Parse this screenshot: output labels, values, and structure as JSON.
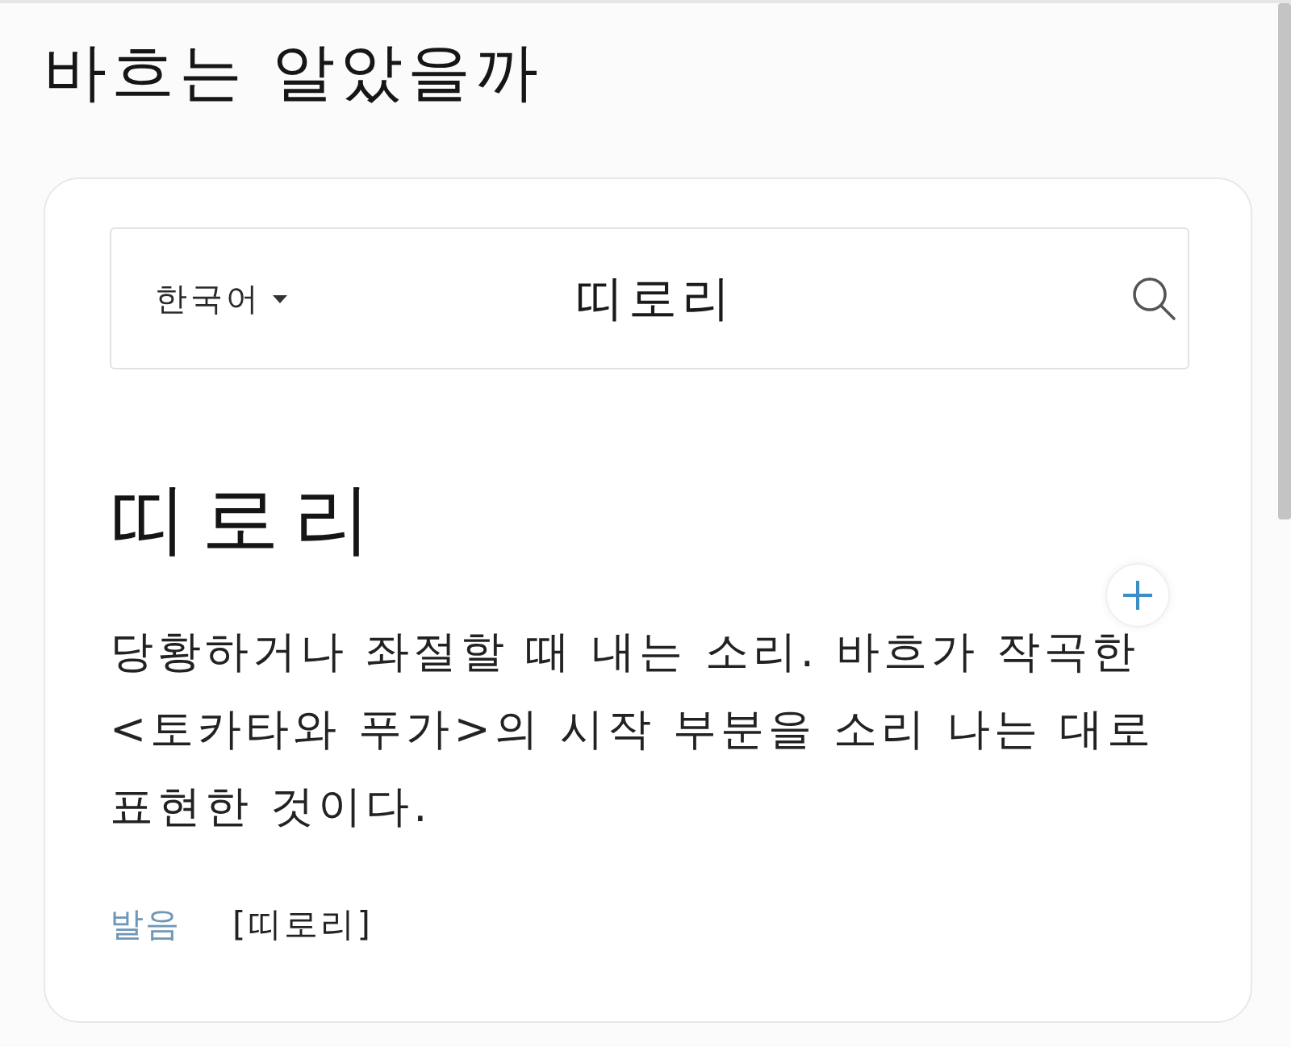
{
  "page": {
    "title": "바흐는 알았을까"
  },
  "search": {
    "language": "한국어",
    "value": "띠로리"
  },
  "entry": {
    "headword": "띠로리",
    "definition": "당황하거나 좌절할 때 내는 소리. 바흐가 작곡한 <토카타와 푸가>의 시작 부분을 소리 나는 대로 표현한 것이다.",
    "pronunciation_label": "발음",
    "pronunciation": "[띠로리]"
  }
}
